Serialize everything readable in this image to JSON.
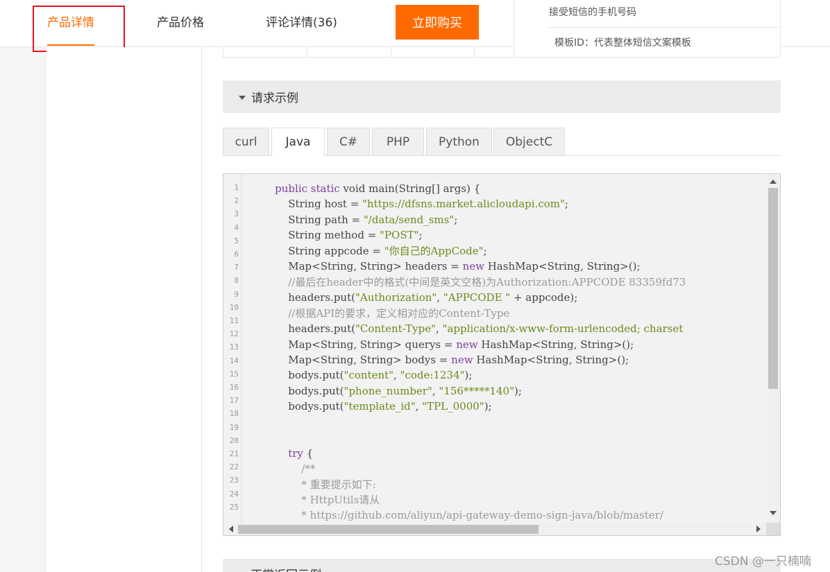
{
  "nav": {
    "tabs": [
      {
        "label": "产品详情",
        "active": true
      },
      {
        "label": "产品价格",
        "active": false
      },
      {
        "label": "评论详情(36)",
        "active": false
      }
    ],
    "buy_button": "立即购买"
  },
  "params": {
    "row1": "接受短信的手机号码",
    "row2": "模板ID：代表整体短信文案模板"
  },
  "section": {
    "title": "请求示例"
  },
  "languages": [
    {
      "label": "curl",
      "active": false
    },
    {
      "label": "Java",
      "active": true
    },
    {
      "label": "C#",
      "active": false
    },
    {
      "label": "PHP",
      "active": false
    },
    {
      "label": "Python",
      "active": false
    },
    {
      "label": "ObjectC",
      "active": false
    }
  ],
  "code": {
    "line_numbers": [
      "1",
      "2",
      "3",
      "4",
      "5",
      "6",
      "7",
      "8",
      "9",
      "10",
      "11",
      "12",
      "13",
      "14",
      "15",
      "16",
      "17",
      "18",
      "19",
      "20",
      "21",
      "22",
      "23",
      "24",
      "25"
    ],
    "lines": [
      [
        {
          "t": "        "
        },
        {
          "t": "public static",
          "c": "kw"
        },
        {
          "t": " void main(String[] args) {"
        }
      ],
      [
        {
          "t": "            String host = "
        },
        {
          "t": "\"https://dfsns.market.alicloudapi.com\"",
          "c": "str"
        },
        {
          "t": ";"
        }
      ],
      [
        {
          "t": "            String path = "
        },
        {
          "t": "\"/data/send_sms\"",
          "c": "str"
        },
        {
          "t": ";"
        }
      ],
      [
        {
          "t": "            String method = "
        },
        {
          "t": "\"POST\"",
          "c": "str"
        },
        {
          "t": ";"
        }
      ],
      [
        {
          "t": "            String appcode = "
        },
        {
          "t": "\"你自己的AppCode\"",
          "c": "str"
        },
        {
          "t": ";"
        }
      ],
      [
        {
          "t": "            Map<String, String> headers = "
        },
        {
          "t": "new",
          "c": "kw"
        },
        {
          "t": " HashMap<String, String>();"
        }
      ],
      [
        {
          "t": "            "
        },
        {
          "t": "//最后在header中的格式(中间是英文空格)为Authorization:APPCODE 83359fd73",
          "c": "cm"
        }
      ],
      [
        {
          "t": "            headers.put("
        },
        {
          "t": "\"Authorization\"",
          "c": "str"
        },
        {
          "t": ", "
        },
        {
          "t": "\"APPCODE \"",
          "c": "str"
        },
        {
          "t": " + appcode);"
        }
      ],
      [
        {
          "t": "            "
        },
        {
          "t": "//根据API的要求，定义相对应的Content-Type",
          "c": "cm"
        }
      ],
      [
        {
          "t": "            headers.put("
        },
        {
          "t": "\"Content-Type\"",
          "c": "str"
        },
        {
          "t": ", "
        },
        {
          "t": "\"application/x-www-form-urlencoded; charset",
          "c": "str"
        }
      ],
      [
        {
          "t": "            Map<String, String> querys = "
        },
        {
          "t": "new",
          "c": "kw"
        },
        {
          "t": " HashMap<String, String>();"
        }
      ],
      [
        {
          "t": "            Map<String, String> bodys = "
        },
        {
          "t": "new",
          "c": "kw"
        },
        {
          "t": " HashMap<String, String>();"
        }
      ],
      [
        {
          "t": "            bodys.put("
        },
        {
          "t": "\"content\"",
          "c": "str"
        },
        {
          "t": ", "
        },
        {
          "t": "\"code:1234\"",
          "c": "str"
        },
        {
          "t": ");"
        }
      ],
      [
        {
          "t": "            bodys.put("
        },
        {
          "t": "\"phone_number\"",
          "c": "str"
        },
        {
          "t": ", "
        },
        {
          "t": "\"156*****140\"",
          "c": "str"
        },
        {
          "t": ");"
        }
      ],
      [
        {
          "t": "            bodys.put("
        },
        {
          "t": "\"template_id\"",
          "c": "str"
        },
        {
          "t": ", "
        },
        {
          "t": "\"TPL_0000\"",
          "c": "str"
        },
        {
          "t": ");"
        }
      ],
      [
        {
          "t": ""
        }
      ],
      [
        {
          "t": ""
        }
      ],
      [
        {
          "t": "            "
        },
        {
          "t": "try",
          "c": "kw"
        },
        {
          "t": " {"
        }
      ],
      [
        {
          "t": "                "
        },
        {
          "t": "/**",
          "c": "cm"
        }
      ],
      [
        {
          "t": "                "
        },
        {
          "t": "* 重要提示如下:",
          "c": "cm"
        }
      ],
      [
        {
          "t": "                "
        },
        {
          "t": "* HttpUtils请从",
          "c": "cm"
        }
      ],
      [
        {
          "t": "                "
        },
        {
          "t": "* https://github.com/aliyun/api-gateway-demo-sign-java/blob/master/",
          "c": "cm"
        }
      ]
    ]
  },
  "next_section": {
    "title": "正常返回示例"
  },
  "watermark": "CSDN @一只楠喃"
}
